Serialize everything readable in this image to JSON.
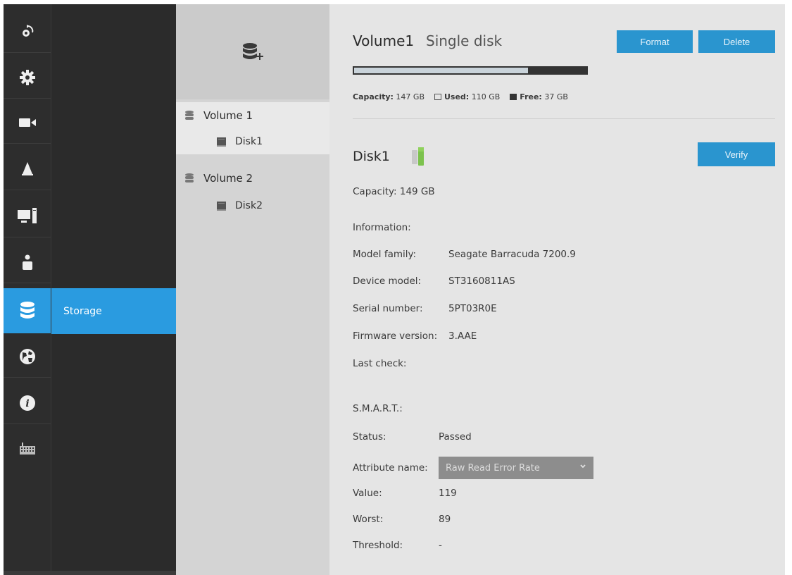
{
  "nav": {
    "rail_icons": [
      "camera-rotate-icon",
      "gear-icon",
      "video-camera-icon",
      "bell-icon",
      "monitor-icon",
      "user-icon",
      "database-icon",
      "globe-icon",
      "info-icon",
      "keyboard-icon"
    ],
    "active_item_label": "Storage"
  },
  "tree": {
    "add_icon": "add-volume-icon",
    "volumes": [
      {
        "label": "Volume 1",
        "disks": [
          "Disk1"
        ]
      },
      {
        "label": "Volume 2",
        "disks": [
          "Disk2"
        ]
      }
    ]
  },
  "volume": {
    "name": "Volume1",
    "type": "Single disk",
    "format_label": "Format",
    "delete_label": "Delete",
    "capacity_label": "Capacity:",
    "capacity_value": "147 GB",
    "used_label": "Used:",
    "used_value": "110 GB",
    "free_label": "Free:",
    "free_value": "37 GB",
    "used_fraction": 0.748
  },
  "disk": {
    "name": "Disk1",
    "verify_label": "Verify",
    "capacity_text": "Capacity: 149 GB",
    "information_label": "Information:",
    "model_family_label": "Model family:",
    "model_family_value": "Seagate Barracuda 7200.9",
    "device_model_label": "Device model:",
    "device_model_value": "ST3160811AS",
    "serial_label": "Serial number:",
    "serial_value": "5PT03R0E",
    "firmware_label": "Firmware version:",
    "firmware_value": "3.AAE",
    "last_check_label": "Last check:",
    "smart_label": "S.M.A.R.T.:",
    "status_label": "Status:",
    "status_value": "Passed",
    "attribute_label": "Attribute name:",
    "attribute_value": "Raw Read Error Rate",
    "value_label": "Value:",
    "value_value": "119",
    "worst_label": "Worst:",
    "worst_value": "89",
    "threshold_label": "Threshold:",
    "threshold_value": "-"
  },
  "colors": {
    "accent": "#2a9be0",
    "button": "#2a95cf",
    "rail": "#2d2d2d",
    "panel": "#e5e5e5",
    "tree": "#d4d4d4"
  }
}
